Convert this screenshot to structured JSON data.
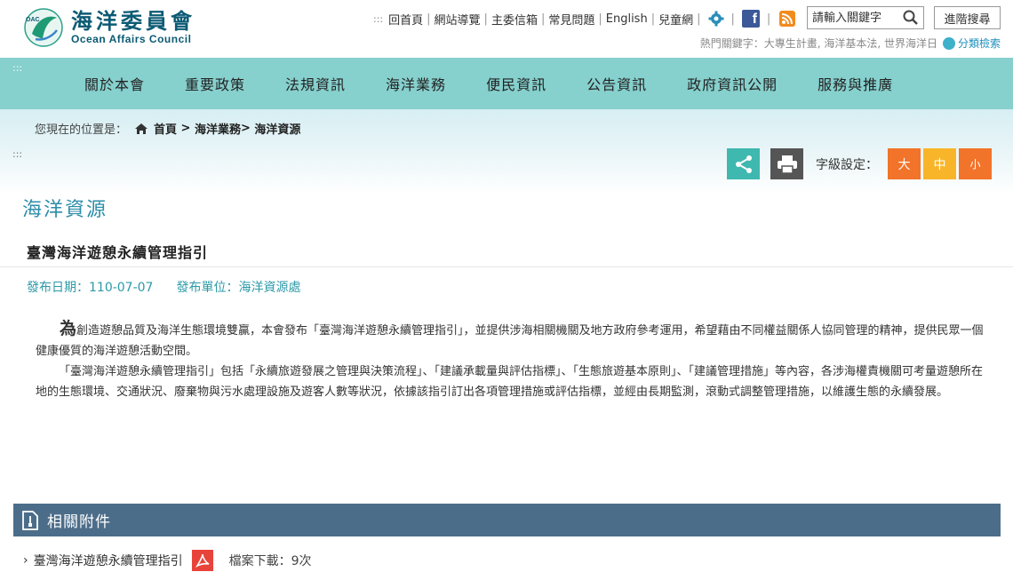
{
  "header": {
    "logo_cn": "海洋委員會",
    "logo_en": "Ocean Affairs Council",
    "logo_badge": "OAC",
    "top_links": [
      "回首頁",
      "網站導覽",
      "主委信箱",
      "常見問題",
      "English",
      "兒童網"
    ],
    "search_placeholder": "請輸入關鍵字",
    "advanced_search": "進階搜尋",
    "hot_label": "熱門關鍵字：",
    "hot_keywords": "大專生計畫, 海洋基本法, 世界海洋日",
    "category_search": "分類檢索",
    "accent_color": "#86d0cd"
  },
  "nav": {
    "items": [
      "關於本會",
      "重要政策",
      "法規資訊",
      "海洋業務",
      "便民資訊",
      "公告資訊",
      "政府資訊公開",
      "服務與推廣"
    ]
  },
  "breadcrumb": {
    "prefix": "您現在的位置是：",
    "home": "首頁",
    "level1": "海洋業務",
    "level2": "海洋資源"
  },
  "tools": {
    "font_label": "字級設定：",
    "font_large": "大",
    "font_medium": "中",
    "font_small": "小"
  },
  "page": {
    "section_title": "海洋資源",
    "article_title": "臺灣海洋遊憩永續管理指引",
    "publish_date": "發布日期：110-07-07",
    "publish_unit": "發布單位：海洋資源處",
    "lead_char": "為",
    "para1_rest": "創造遊憩品質及海洋生態環境雙贏，本會發布「臺灣海洋遊憩永續管理指引」，並提供涉海相關機關及地方政府參考運用，希望藉由不同權益關係人協同管理的精神，提供民眾一個健康優質的海洋遊憩活動空間。",
    "para2": "「臺灣海洋遊憩永續管理指引」包括「永續旅遊發展之管理與決策流程」、「建議承載量與評估指標」、「生態旅遊基本原則」、「建議管理措施」等內容，各涉海權責機關可考量遊憩所在地的生態環境、交通狀況、廢棄物與污水處理設施及遊客人數等狀況，依據該指引訂出各項管理措施或評估指標，並經由長期監測，滾動式調整管理措施，以維護生態的永續發展。"
  },
  "attachments": {
    "title": "相關附件",
    "file_name": "臺灣海洋遊憩永續管理指引",
    "downloads": "檔案下載：9次"
  }
}
